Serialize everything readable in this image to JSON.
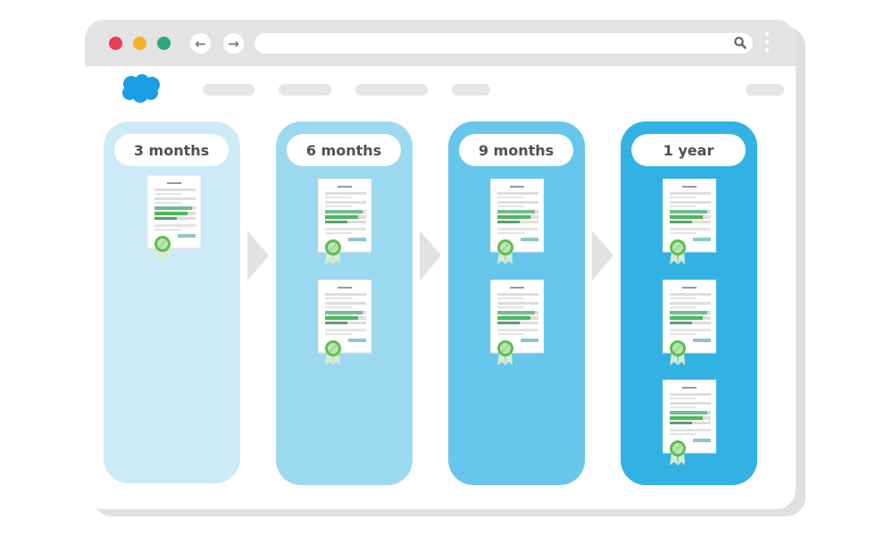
{
  "browser": {
    "window_controls": [
      {
        "name": "close",
        "color": "#ec3c54"
      },
      {
        "name": "minimize",
        "color": "#f6b328"
      },
      {
        "name": "maximize",
        "color": "#2aa87b"
      }
    ],
    "back_icon": "←",
    "forward_icon": "→",
    "url": "",
    "search_icon": "search-icon",
    "menu_icon": "kebab-menu-icon"
  },
  "header": {
    "logo": "salesforce-cloud-logo",
    "logo_color": "#1b9fe4",
    "nav_placeholders": 4,
    "right_placeholder": 1
  },
  "timeline": [
    {
      "label": "3 months",
      "documents": 1,
      "color": "#cdeaf7"
    },
    {
      "label": "6 months",
      "documents": 2,
      "color": "#9bd9f1"
    },
    {
      "label": "9 months",
      "documents": 2,
      "color": "#66c6eb"
    },
    {
      "label": "1 year",
      "documents": 3,
      "color": "#32b2e3"
    }
  ],
  "document": {
    "icon": "certified-document-icon",
    "bar_colors": [
      "#6fbf8e",
      "#4cb85c",
      "#5e9f6b"
    ],
    "seal_color": "#5bbf4e",
    "button_color": "#8dc6cf"
  },
  "arrow_icon": "chevron-right-arrow"
}
